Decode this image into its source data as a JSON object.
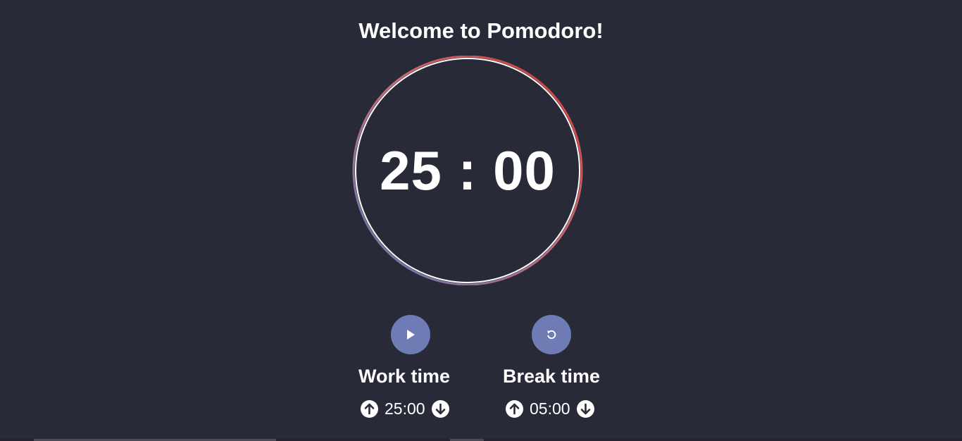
{
  "header": {
    "title": "Welcome to Pomodoro!"
  },
  "timer": {
    "display": "25 : 00",
    "ring_colors": {
      "top_right": "#d6372a",
      "bottom_left": "#5b7bb5",
      "inner": "#ffffff"
    }
  },
  "controls": {
    "play_icon": "play-icon",
    "reset_icon": "reset-icon",
    "button_color": "#6f7bb4"
  },
  "work": {
    "label": "Work time",
    "value": "25:00"
  },
  "break": {
    "label": "Break time",
    "value": "05:00"
  },
  "colors": {
    "background": "#282a38",
    "text": "#ffffff"
  }
}
